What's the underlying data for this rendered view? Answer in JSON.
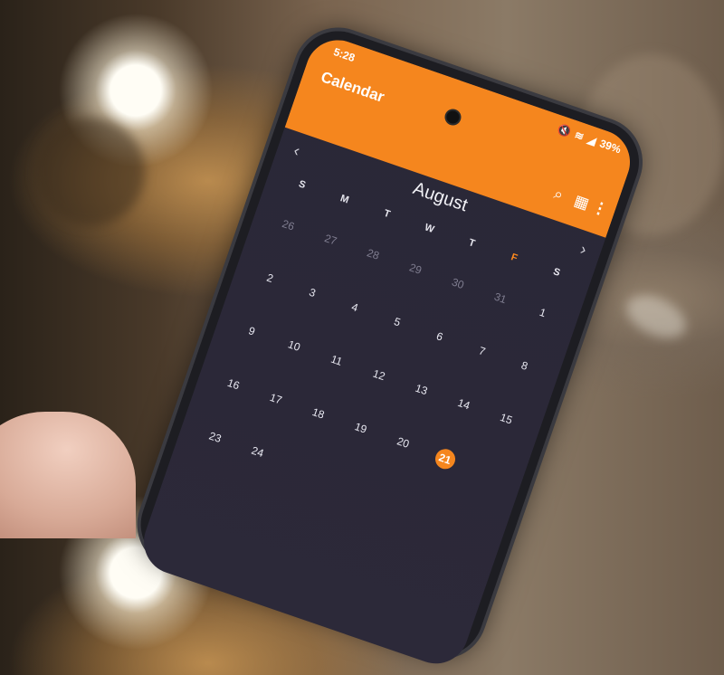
{
  "status_bar": {
    "time": "5:28",
    "battery": "39%"
  },
  "header": {
    "title": "Calendar"
  },
  "calendar": {
    "month": "August",
    "weekdays": [
      "S",
      "M",
      "T",
      "W",
      "T",
      "F",
      "S"
    ],
    "today_weekday_index": 5,
    "weeks": [
      [
        "26",
        "27",
        "28",
        "29",
        "30",
        "31",
        "1"
      ],
      [
        "2",
        "3",
        "4",
        "5",
        "6",
        "7",
        "8"
      ],
      [
        "9",
        "10",
        "11",
        "12",
        "13",
        "14",
        "15"
      ],
      [
        "16",
        "17",
        "18",
        "19",
        "20",
        "21",
        ""
      ],
      [
        "23",
        "24",
        "",
        "",
        "",
        "",
        ""
      ]
    ],
    "muted_first_row_count": 6,
    "highlight_day": "21"
  },
  "colors": {
    "accent": "#f5861e",
    "screen_bg": "#2a2837"
  }
}
